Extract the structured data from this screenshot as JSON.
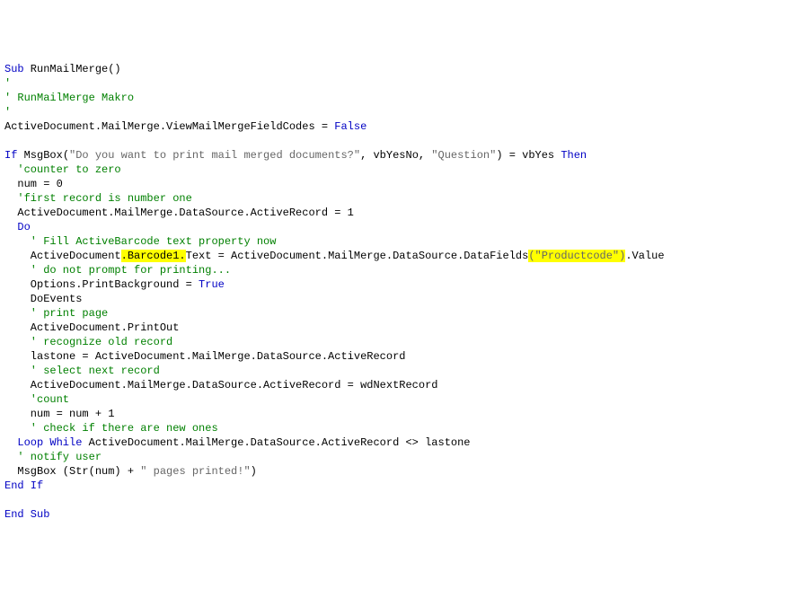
{
  "code": {
    "l01_kw1": "Sub",
    "l01_fn": " RunMailMerge()",
    "l02_cm": "'",
    "l03_cm": "' RunMailMerge Makro",
    "l04_cm": "'",
    "l05_a": "ActiveDocument.MailMerge.ViewMailMergeFieldCodes = ",
    "l05_kw": "False",
    "l07_kw1": "If",
    "l07_a": " MsgBox(",
    "l07_s1": "\"Do you want to print mail merged documents?\"",
    "l07_b": ", vbYesNo, ",
    "l07_s2": "\"Question\"",
    "l07_c": ") = vbYes ",
    "l07_kw2": "Then",
    "l08_cm": "  'counter to zero",
    "l09": "  num = 0",
    "l10_cm": "  'first record is number one",
    "l11": "  ActiveDocument.MailMerge.DataSource.ActiveRecord = 1",
    "l12_kw": "  Do",
    "l13_cm": "    ' Fill ActiveBarcode text property now",
    "l14_a": "    ActiveDocument",
    "l14_hl": ".Barcode1.",
    "l14_b": "Text = ActiveDocument.MailMerge.DataSource.DataFields",
    "l14_s": "(\"Productcode\")",
    "l14_c": ".Value",
    "l15_cm": "    ' do not prompt for printing...",
    "l16_a": "    Options.PrintBackground = ",
    "l16_kw": "True",
    "l17": "    DoEvents",
    "l18_cm": "    ' print page",
    "l19": "    ActiveDocument.PrintOut",
    "l20_cm": "    ' recognize old record",
    "l21": "    lastone = ActiveDocument.MailMerge.DataSource.ActiveRecord",
    "l22_cm": "    ' select next record",
    "l23": "    ActiveDocument.MailMerge.DataSource.ActiveRecord = wdNextRecord",
    "l24_cm": "    'count",
    "l25": "    num = num + 1",
    "l26_cm": "    ' check if there are new ones",
    "l27_kw": "  Loop While",
    "l27_a": " ActiveDocument.MailMerge.DataSource.ActiveRecord <> lastone",
    "l28_cm": "  ' notify user",
    "l29_a": "  MsgBox (Str(num) + ",
    "l29_s": "\" pages printed!\"",
    "l29_b": ")",
    "l30_kw": "End If",
    "l32_kw": "End Sub"
  }
}
